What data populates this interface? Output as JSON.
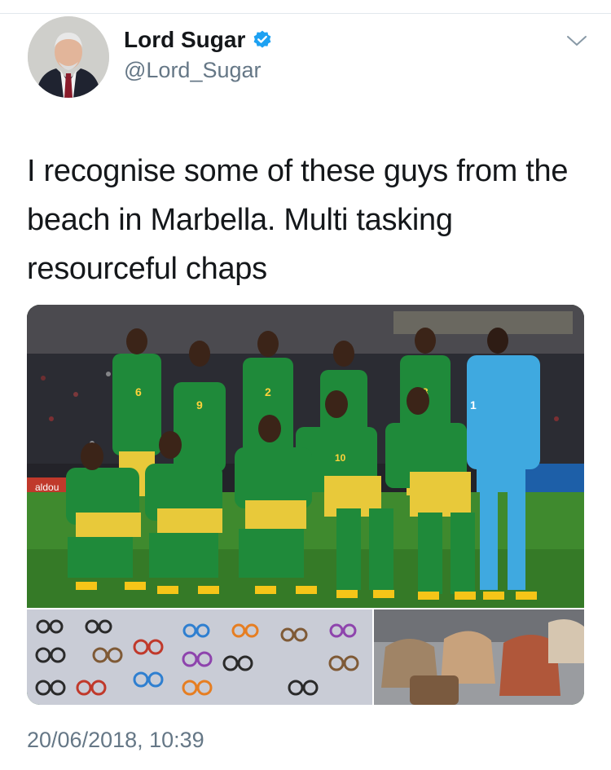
{
  "tweet": {
    "author": {
      "display_name": "Lord Sugar",
      "handle": "@Lord_Sugar",
      "verified_icon": "verified-badge-icon"
    },
    "text": "I recognise some of these guys from the beach in Marbella. Multi tasking resourceful chaps",
    "timestamp": "20/06/2018, 10:39"
  },
  "media": {
    "team_photo": {
      "shirt_numbers": [
        "6",
        "9",
        "2",
        "3",
        "1",
        "10"
      ],
      "board_text": "aldou"
    },
    "sunglasses_photo": {},
    "bags_photo": {}
  },
  "colors": {
    "accent": "#1da1f2",
    "text": "#14171a",
    "secondary": "#657786"
  }
}
